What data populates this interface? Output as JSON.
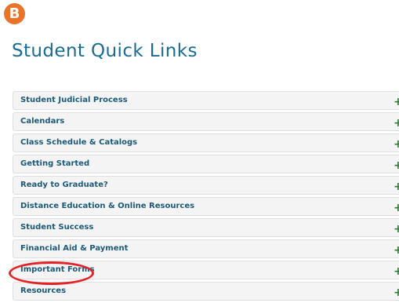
{
  "badge": {
    "letter": "B"
  },
  "page": {
    "title": "Student Quick Links"
  },
  "accordion": {
    "items": [
      {
        "label": "Student Judicial Process",
        "toggle": "+"
      },
      {
        "label": "Calendars",
        "toggle": "+"
      },
      {
        "label": "Class Schedule & Catalogs",
        "toggle": "+"
      },
      {
        "label": "Getting Started",
        "toggle": "+"
      },
      {
        "label": "Ready to Graduate?",
        "toggle": "+"
      },
      {
        "label": "Distance Education & Online Resources",
        "toggle": "+"
      },
      {
        "label": "Student Success",
        "toggle": "+"
      },
      {
        "label": "Financial Aid & Payment",
        "toggle": "+"
      },
      {
        "label": "Important Forms",
        "toggle": "+"
      },
      {
        "label": "Resources",
        "toggle": "+"
      }
    ]
  },
  "annotation": {
    "highlighted_item": "Important Forms",
    "color": "#e3222a"
  },
  "colors": {
    "badge": "#e8742a",
    "title": "#1a6b8f",
    "item_label": "#1d5a78",
    "plus": "#2e7d32",
    "item_bg": "#f4f4f4"
  }
}
